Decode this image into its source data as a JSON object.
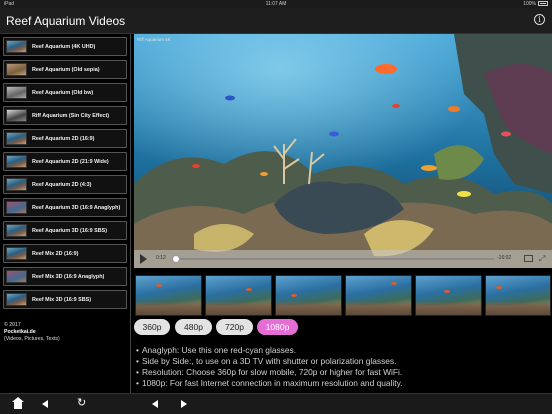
{
  "status_bar": {
    "left": "iPad",
    "time": "11:07 AM",
    "right": "100%"
  },
  "header": {
    "title": "Reef Aquarium Videos",
    "info_icon": "info-circle-icon"
  },
  "sidebar": {
    "items": [
      {
        "label": "Reef Aquarium (4K UHD)"
      },
      {
        "label": "Reef Aquarium (Old sepia)"
      },
      {
        "label": "Reef Aquarium (Old bw)"
      },
      {
        "label": "Riff Aquarium (Sin City Effect)"
      },
      {
        "label": "Reef Aquarium 2D (16:9)"
      },
      {
        "label": "Reef Aquarium 2D (21:9 Wide)"
      },
      {
        "label": "Reef Aquarium 2D (4:3)"
      },
      {
        "label": "Reef Aquarium 3D (16:9 Anaglyph)"
      },
      {
        "label": "Reef Aquarium 3D (16:9 SBS)"
      },
      {
        "label": "Reef Mix 2D (16:9)"
      },
      {
        "label": "Reef Mix 3D (16:9 Anaglyph)"
      },
      {
        "label": "Reef Mix 3D (16:9 SBS)"
      }
    ],
    "copyright": {
      "year": "© 2017",
      "brand": "Pocketkai.de",
      "note": "(Videos, Pictures, Texts)"
    }
  },
  "player": {
    "video_title": "Riff Aquarium 4K",
    "elapsed": "0:12",
    "remaining": "-16:02",
    "progress": 0.012
  },
  "resolutions": [
    {
      "label": "360p",
      "active": false
    },
    {
      "label": "480p",
      "active": false
    },
    {
      "label": "720p",
      "active": false
    },
    {
      "label": "1080p",
      "active": true
    }
  ],
  "info": [
    "Anaglyph: Use this one red-cyan glasses.",
    "Side by Side:, to use on a 3D TV with shutter or polarization glasses.",
    "Resolution: Choose 360p for slow mobile, 720p or higher for fast WiFi.",
    "1080p: For fast Internet connection in maximum resolution and quality."
  ],
  "toolbar": {
    "icons": [
      "home-icon",
      "back-arrow-icon",
      "reload-icon",
      "previous-icon",
      "next-icon"
    ]
  },
  "colors": {
    "accent": "#e56ed6",
    "background": "#000000",
    "water": "#1d6a95"
  }
}
